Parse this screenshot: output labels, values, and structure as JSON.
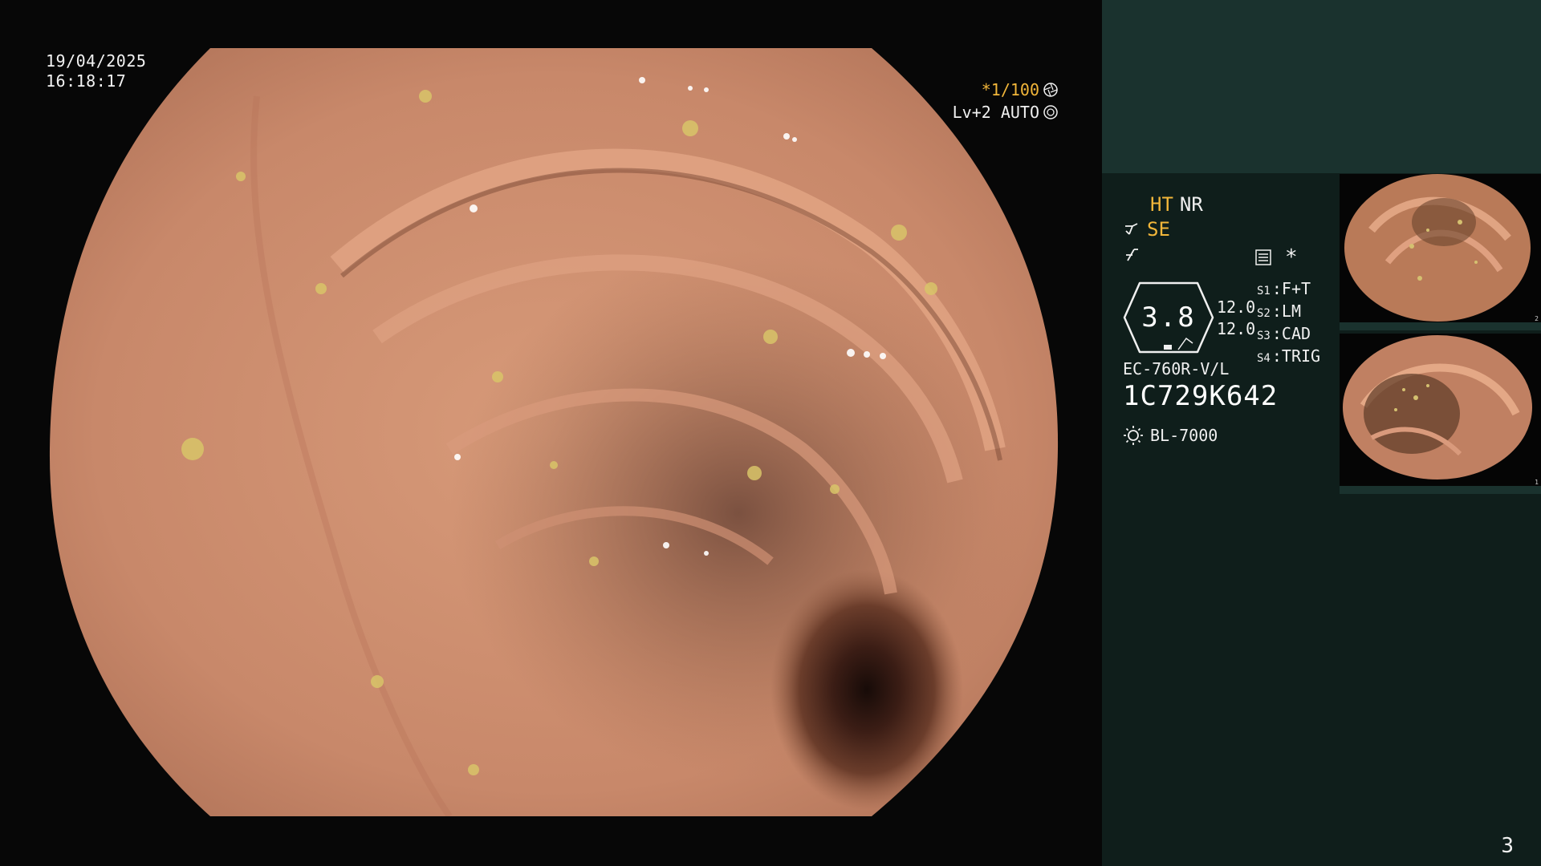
{
  "overlay": {
    "date": "19/04/2025",
    "time": "16:18:17",
    "shutter": "*1/100",
    "level": "Lv+2 AUTO"
  },
  "panel": {
    "mode_ht": "HT",
    "mode_nr": "NR",
    "mode_se": "SE",
    "gauge_value": "3.8",
    "gauge_setting_1": "12.0",
    "gauge_setting_2": "12.0",
    "asterisk": "*",
    "switches": [
      {
        "key": "S1",
        "value": "F+T"
      },
      {
        "key": "S2",
        "value": "LM"
      },
      {
        "key": "S3",
        "value": "CAD"
      },
      {
        "key": "S4",
        "value": "TRIG"
      }
    ],
    "scope_model": "EC-760R-V/L",
    "scope_serial": "1C729K642",
    "light_source": "BL-7000"
  },
  "thumbnails": [
    {
      "number": "2"
    },
    {
      "number": "1"
    }
  ],
  "page_number": "3",
  "colors": {
    "orange_accent": "#f2b63a",
    "panel_bg": "#0f1e1b",
    "panel_top": "#1a322e",
    "mucosa": "#c98a6a"
  },
  "icons": {
    "shutter": "aperture-icon",
    "level": "iris-icon",
    "scissors": "cutter-icon",
    "hook": "hook-icon",
    "menu": "menu-list-icon",
    "light": "sun-icon"
  }
}
